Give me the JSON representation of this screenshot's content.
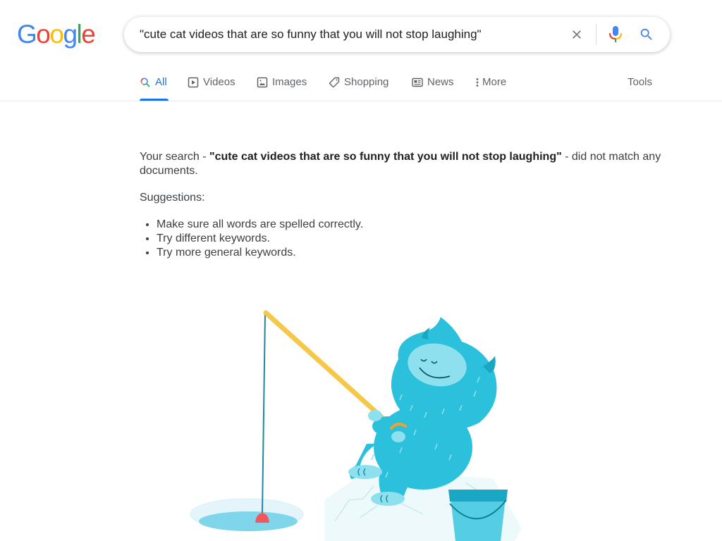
{
  "logo": {
    "text": "Google",
    "letters": [
      {
        "char": "G",
        "color": "#4285f4"
      },
      {
        "char": "o",
        "color": "#ea4335"
      },
      {
        "char": "o",
        "color": "#fbbc05"
      },
      {
        "char": "g",
        "color": "#4285f4"
      },
      {
        "char": "l",
        "color": "#34a853"
      },
      {
        "char": "e",
        "color": "#ea4335"
      }
    ]
  },
  "search": {
    "value": "\"cute cat videos that are so funny that you will not stop laughing\"",
    "clear_icon": "close-icon",
    "mic_icon": "microphone-icon",
    "search_icon": "search-icon"
  },
  "tabs": [
    {
      "label": "All",
      "icon": "search-icon",
      "active": true
    },
    {
      "label": "Videos",
      "icon": "play-icon",
      "active": false
    },
    {
      "label": "Images",
      "icon": "image-icon",
      "active": false
    },
    {
      "label": "Shopping",
      "icon": "tag-icon",
      "active": false
    },
    {
      "label": "News",
      "icon": "newspaper-icon",
      "active": false
    },
    {
      "label": "More",
      "icon": "more-vert-icon",
      "active": false
    }
  ],
  "tools_label": "Tools",
  "results": {
    "prefix": "Your search - ",
    "query": "\"cute cat videos that are so funny that you will not stop laughing\"",
    "suffix": " - did not match any documents.",
    "suggestions_title": "Suggestions:",
    "suggestions": [
      "Make sure all words are spelled correctly.",
      "Try different keywords.",
      "Try more general keywords."
    ]
  },
  "illustration": {
    "description": "Blue furry monster ice fishing",
    "colors": {
      "fur": "#2bc0db",
      "fur_light": "#8ee0ee",
      "rod": "#f6c84a",
      "bobber": "#f4545a",
      "water": "#7fd6ea",
      "bucket": "#2aafcb"
    }
  }
}
